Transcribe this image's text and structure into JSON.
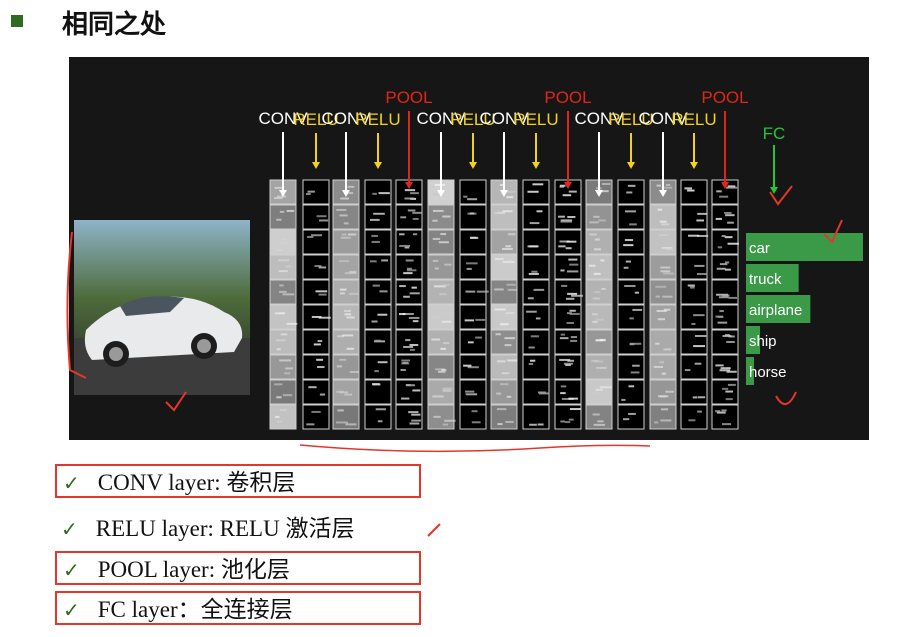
{
  "title": "相同之处",
  "figure": {
    "top_labels": [
      "CONV",
      "RELU",
      "CONV",
      "RELU",
      "POOL",
      "CONV",
      "RELU",
      "CONV",
      "RELU",
      "POOL",
      "CONV",
      "RELU",
      "CONV",
      "RELU",
      "POOL",
      "FC"
    ],
    "classes": [
      "car",
      "truck",
      "airplane",
      "ship",
      "horse"
    ],
    "class_scores": [
      1.0,
      0.45,
      0.55,
      0.12,
      0.06
    ],
    "colors": {
      "conv": "#ffffff",
      "relu": "#f2d21e",
      "pool": "#e0261b",
      "fc": "#27c43a",
      "bar": "#3a9a48",
      "annotation": "#e5362b"
    }
  },
  "list": [
    {
      "check": "✓",
      "text": "CONV layer: 卷积层"
    },
    {
      "check": "✓",
      "text": "RELU layer: RELU 激活层"
    },
    {
      "check": "✓",
      "text": "POOL layer: 池化层"
    },
    {
      "check": "✓",
      "text": "FC layer：全连接层"
    }
  ]
}
